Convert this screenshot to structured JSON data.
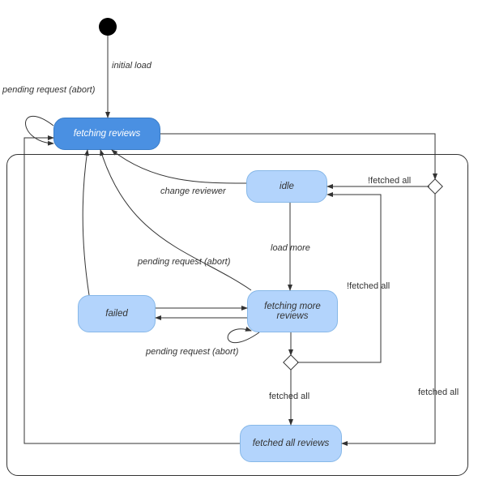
{
  "states": {
    "fetching_reviews": "fetching reviews",
    "idle": "idle",
    "failed": "failed",
    "fetching_more": "fetching more reviews",
    "fetched_all": "fetched all reviews"
  },
  "transitions": {
    "initial_load": "initial load",
    "pending_abort_1": "pending request (abort)",
    "change_reviewer": "change reviewer",
    "load_more": "load more",
    "pending_abort_2": "pending request (abort)",
    "pending_abort_3": "pending request (abort)",
    "not_fetched_all_1": "!fetched all",
    "not_fetched_all_2": "!fetched all",
    "fetched_all_1": "fetched all",
    "fetched_all_2": "fetched all"
  }
}
